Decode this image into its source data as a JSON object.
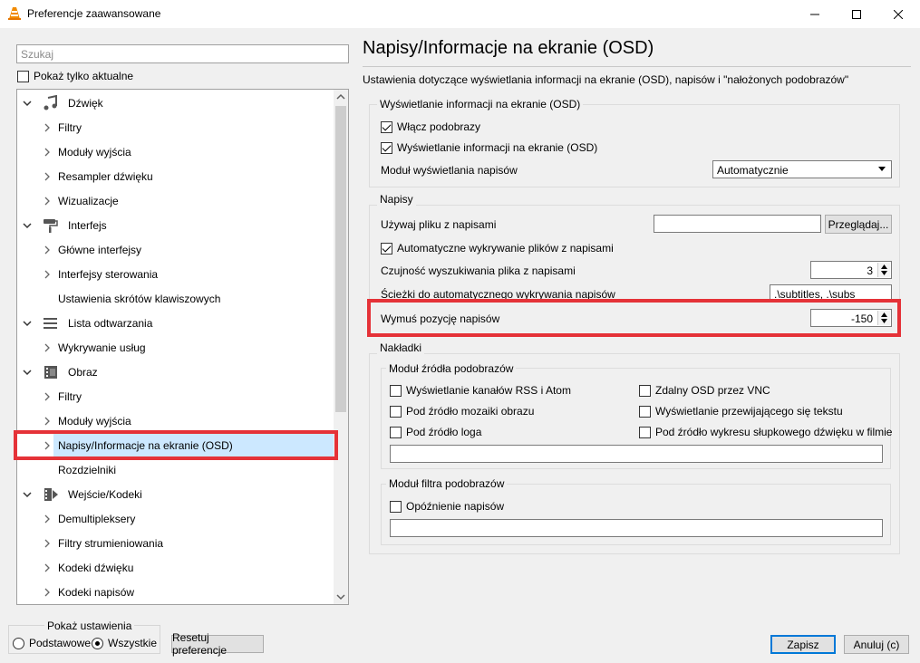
{
  "window": {
    "title": "Preferencje zaawansowane",
    "icon": "vlc-cone-icon"
  },
  "left": {
    "search_placeholder": "Szukaj",
    "only_current_label": "Pokaż tylko aktualne",
    "only_current_checked": false,
    "tree": [
      {
        "label": "Dźwięk",
        "level": 0,
        "expanded": true,
        "icon": "music-note-icon"
      },
      {
        "label": "Filtry",
        "level": 1,
        "has_children": true
      },
      {
        "label": "Moduły wyjścia",
        "level": 1,
        "has_children": true
      },
      {
        "label": "Resampler dźwięku",
        "level": 1,
        "has_children": true
      },
      {
        "label": "Wizualizacje",
        "level": 1,
        "has_children": true
      },
      {
        "label": "Interfejs",
        "level": 0,
        "expanded": true,
        "icon": "paint-roller-icon"
      },
      {
        "label": "Główne interfejsy",
        "level": 1,
        "has_children": true
      },
      {
        "label": "Interfejsy sterowania",
        "level": 1,
        "has_children": true
      },
      {
        "label": "Ustawienia skrótów klawiszowych",
        "level": 1,
        "has_children": false
      },
      {
        "label": "Lista odtwarzania",
        "level": 0,
        "expanded": true,
        "icon": "playlist-icon"
      },
      {
        "label": "Wykrywanie usług",
        "level": 1,
        "has_children": true
      },
      {
        "label": "Obraz",
        "level": 0,
        "expanded": true,
        "icon": "film-clapper-icon"
      },
      {
        "label": "Filtry",
        "level": 1,
        "has_children": true
      },
      {
        "label": "Moduły wyjścia",
        "level": 1,
        "has_children": true
      },
      {
        "label": "Napisy/Informacje na ekranie (OSD)",
        "level": 1,
        "has_children": true,
        "selected": true
      },
      {
        "label": "Rozdzielniki",
        "level": 1,
        "has_children": false
      },
      {
        "label": "Wejście/Kodeki",
        "level": 0,
        "expanded": true,
        "icon": "film-codec-icon"
      },
      {
        "label": "Demultipleksery",
        "level": 1,
        "has_children": true
      },
      {
        "label": "Filtry strumieniowania",
        "level": 1,
        "has_children": true
      },
      {
        "label": "Kodeki dźwięku",
        "level": 1,
        "has_children": true
      },
      {
        "label": "Kodeki napisów",
        "level": 1,
        "has_children": true
      }
    ],
    "show_settings": {
      "title": "Pokaż ustawienia",
      "basic": "Podstawowe",
      "all": "Wszystkie",
      "selected": "all"
    },
    "reset_button": "Resetuj preferencje"
  },
  "main": {
    "heading": "Napisy/Informacje na ekranie (OSD)",
    "description": "Ustawienia dotyczące wyświetlania informacji na ekranie (OSD), napisów i \"nałożonych podobrazów\"",
    "osd_section": {
      "title": "Wyświetlanie informacji na ekranie (OSD)",
      "enable_subpictures": {
        "label": "Włącz podobrazy",
        "checked": true
      },
      "enable_osd": {
        "label": "Wyświetlanie informacji na ekranie (OSD)",
        "checked": true
      },
      "text_module_label": "Moduł wyświetlania napisów",
      "text_module_value": "Automatycznie"
    },
    "subtitles_section": {
      "title": "Napisy",
      "use_file_label": "Używaj pliku z napisami",
      "use_file_value": "",
      "browse_button": "Przeglądaj...",
      "autodetect": {
        "label": "Automatyczne wykrywanie plików z napisami",
        "checked": true
      },
      "fuzziness_label": "Czujność wyszukiwania plika z napisami",
      "fuzziness_value": "3",
      "paths_label": "Ścieżki do automatycznego wykrywania napisów",
      "paths_value": ".\\subtitles, .\\subs",
      "force_position_label": "Wymuś pozycję napisów",
      "force_position_value": "-150"
    },
    "overlays_section": {
      "title": "Nakładki",
      "source_group": {
        "title": "Moduł źródła podobrazów",
        "items": [
          {
            "label": "Wyświetlanie kanałów RSS i Atom",
            "checked": false
          },
          {
            "label": "Zdalny OSD przez VNC",
            "checked": false
          },
          {
            "label": "Pod źródło mozaiki obrazu",
            "checked": false
          },
          {
            "label": "Wyświetlanie przewijającego się tekstu",
            "checked": false
          },
          {
            "label": "Pod źródło loga",
            "checked": false
          },
          {
            "label": "Pod źródło wykresu słupkowego dźwięku w filmie",
            "checked": false
          }
        ],
        "text_value": ""
      },
      "filter_group": {
        "title": "Moduł filtra podobrazów",
        "items": [
          {
            "label": "Opóźnienie napisów",
            "checked": false
          }
        ],
        "text_value": ""
      }
    }
  },
  "footer": {
    "save": "Zapisz",
    "cancel": "Anuluj (c)"
  },
  "colors": {
    "highlight_red": "#e53238",
    "selection": "#cce8ff",
    "accent": "#0078d7"
  }
}
